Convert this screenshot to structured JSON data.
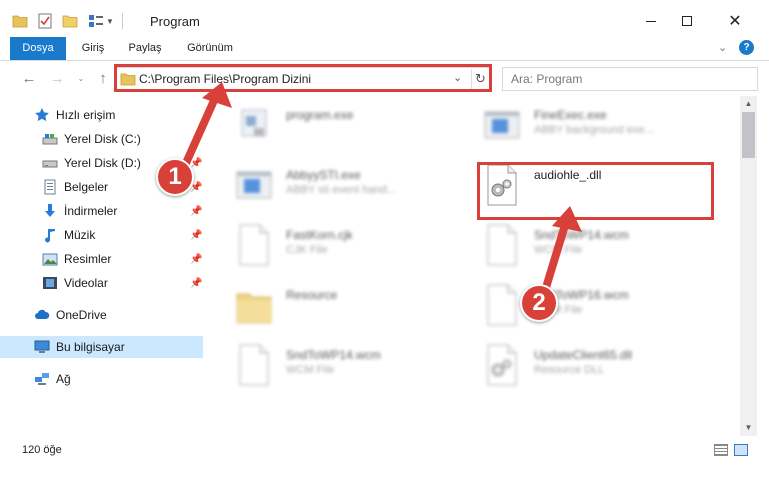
{
  "window": {
    "title": "Program"
  },
  "ribbon": {
    "tabs": [
      {
        "label": "Dosya",
        "active": true
      },
      {
        "label": "Giriş",
        "active": false
      },
      {
        "label": "Paylaş",
        "active": false
      },
      {
        "label": "Görünüm",
        "active": false
      }
    ]
  },
  "address": {
    "path": "C:\\Program Files\\Program Dizini"
  },
  "search": {
    "placeholder": "Ara: Program"
  },
  "sidebar": {
    "items": [
      {
        "label": "Hızlı erişim",
        "icon": "star-icon",
        "pinned": false
      },
      {
        "label": "Yerel Disk (C:)",
        "icon": "drive-icon",
        "pinned": false
      },
      {
        "label": "Yerel Disk (D:)",
        "icon": "drive-icon",
        "pinned": true
      },
      {
        "label": "Belgeler",
        "icon": "document-icon",
        "pinned": true
      },
      {
        "label": "İndirmeler",
        "icon": "download-icon",
        "pinned": true
      },
      {
        "label": "Müzik",
        "icon": "music-icon",
        "pinned": true
      },
      {
        "label": "Resimler",
        "icon": "pictures-icon",
        "pinned": true
      },
      {
        "label": "Videolar",
        "icon": "film-icon",
        "pinned": true
      },
      {
        "label": "OneDrive",
        "icon": "cloud-icon",
        "pinned": false
      },
      {
        "label": "Bu bilgisayar",
        "icon": "computer-icon",
        "pinned": false,
        "selected": true
      },
      {
        "label": "Ağ",
        "icon": "network-icon",
        "pinned": false
      }
    ]
  },
  "files": [
    {
      "name": "program.exe",
      "desc": "",
      "icon": "exe-icon"
    },
    {
      "name": "FineExec.exe",
      "desc": "ABBY background exe...",
      "icon": "app-window-icon"
    },
    {
      "name": "AbbyySTI.exe",
      "desc": "ABBY sti event hand...",
      "icon": "app-window-icon"
    },
    {
      "name": "audiohle_.dll",
      "desc": "",
      "icon": "dll-gear-icon"
    },
    {
      "name": "FastKorn.cjk",
      "desc": "CJK File",
      "icon": "blank-file-icon"
    },
    {
      "name": "SndToWP14.wcm",
      "desc": "WCM File",
      "icon": "blank-file-icon"
    },
    {
      "name": "Resource",
      "desc": "",
      "icon": "folder-icon"
    },
    {
      "name": "SndToWP16.wcm",
      "desc": "WCM File",
      "icon": "blank-file-icon"
    },
    {
      "name": "SndToWP14.wcm",
      "desc": "WCM File",
      "icon": "blank-file-icon"
    },
    {
      "name": "UpdateClient65.dll",
      "desc": "Resource DLL",
      "icon": "dll-gear-icon"
    }
  ],
  "status": {
    "count": "120 öğe"
  },
  "annotations": {
    "step1": "1",
    "step2": "2",
    "color": "#d8403a"
  }
}
